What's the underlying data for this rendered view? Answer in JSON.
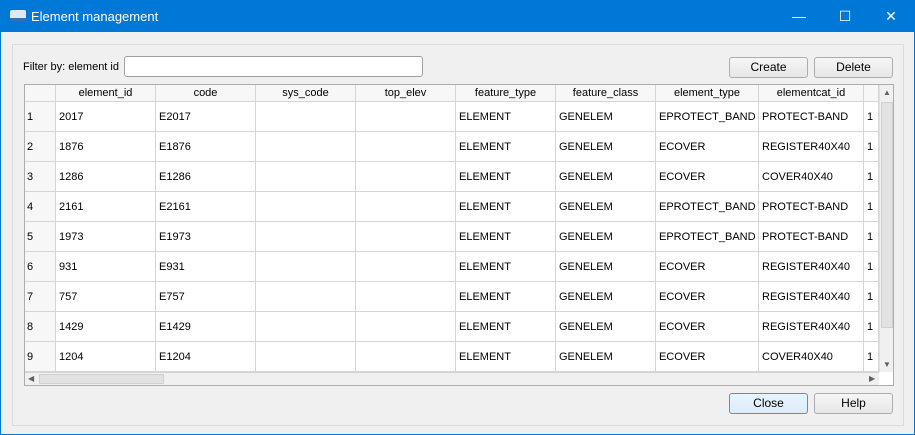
{
  "window": {
    "title": "Element management",
    "minimize": "—",
    "maximize": "☐",
    "close": "✕"
  },
  "filter": {
    "label": "Filter by: element id",
    "value": ""
  },
  "buttons": {
    "create": "Create",
    "delete": "Delete",
    "close": "Close",
    "help": "Help"
  },
  "table": {
    "columns": [
      "element_id",
      "code",
      "sys_code",
      "top_elev",
      "feature_type",
      "feature_class",
      "element_type",
      "elementcat_id",
      ""
    ],
    "rows": [
      [
        "1",
        "2017",
        "E2017",
        "",
        "",
        "ELEMENT",
        "GENELEM",
        "EPROTECT_BAND",
        "PROTECT-BAND",
        "1"
      ],
      [
        "2",
        "1876",
        "E1876",
        "",
        "",
        "ELEMENT",
        "GENELEM",
        "ECOVER",
        "REGISTER40X40",
        "1"
      ],
      [
        "3",
        "1286",
        "E1286",
        "",
        "",
        "ELEMENT",
        "GENELEM",
        "ECOVER",
        "COVER40X40",
        "1"
      ],
      [
        "4",
        "2161",
        "E2161",
        "",
        "",
        "ELEMENT",
        "GENELEM",
        "EPROTECT_BAND",
        "PROTECT-BAND",
        "1"
      ],
      [
        "5",
        "1973",
        "E1973",
        "",
        "",
        "ELEMENT",
        "GENELEM",
        "EPROTECT_BAND",
        "PROTECT-BAND",
        "1"
      ],
      [
        "6",
        "931",
        "E931",
        "",
        "",
        "ELEMENT",
        "GENELEM",
        "ECOVER",
        "REGISTER40X40",
        "1"
      ],
      [
        "7",
        "757",
        "E757",
        "",
        "",
        "ELEMENT",
        "GENELEM",
        "ECOVER",
        "REGISTER40X40",
        "1"
      ],
      [
        "8",
        "1429",
        "E1429",
        "",
        "",
        "ELEMENT",
        "GENELEM",
        "ECOVER",
        "REGISTER40X40",
        "1"
      ],
      [
        "9",
        "1204",
        "E1204",
        "",
        "",
        "ELEMENT",
        "GENELEM",
        "ECOVER",
        "COVER40X40",
        "1"
      ]
    ]
  }
}
